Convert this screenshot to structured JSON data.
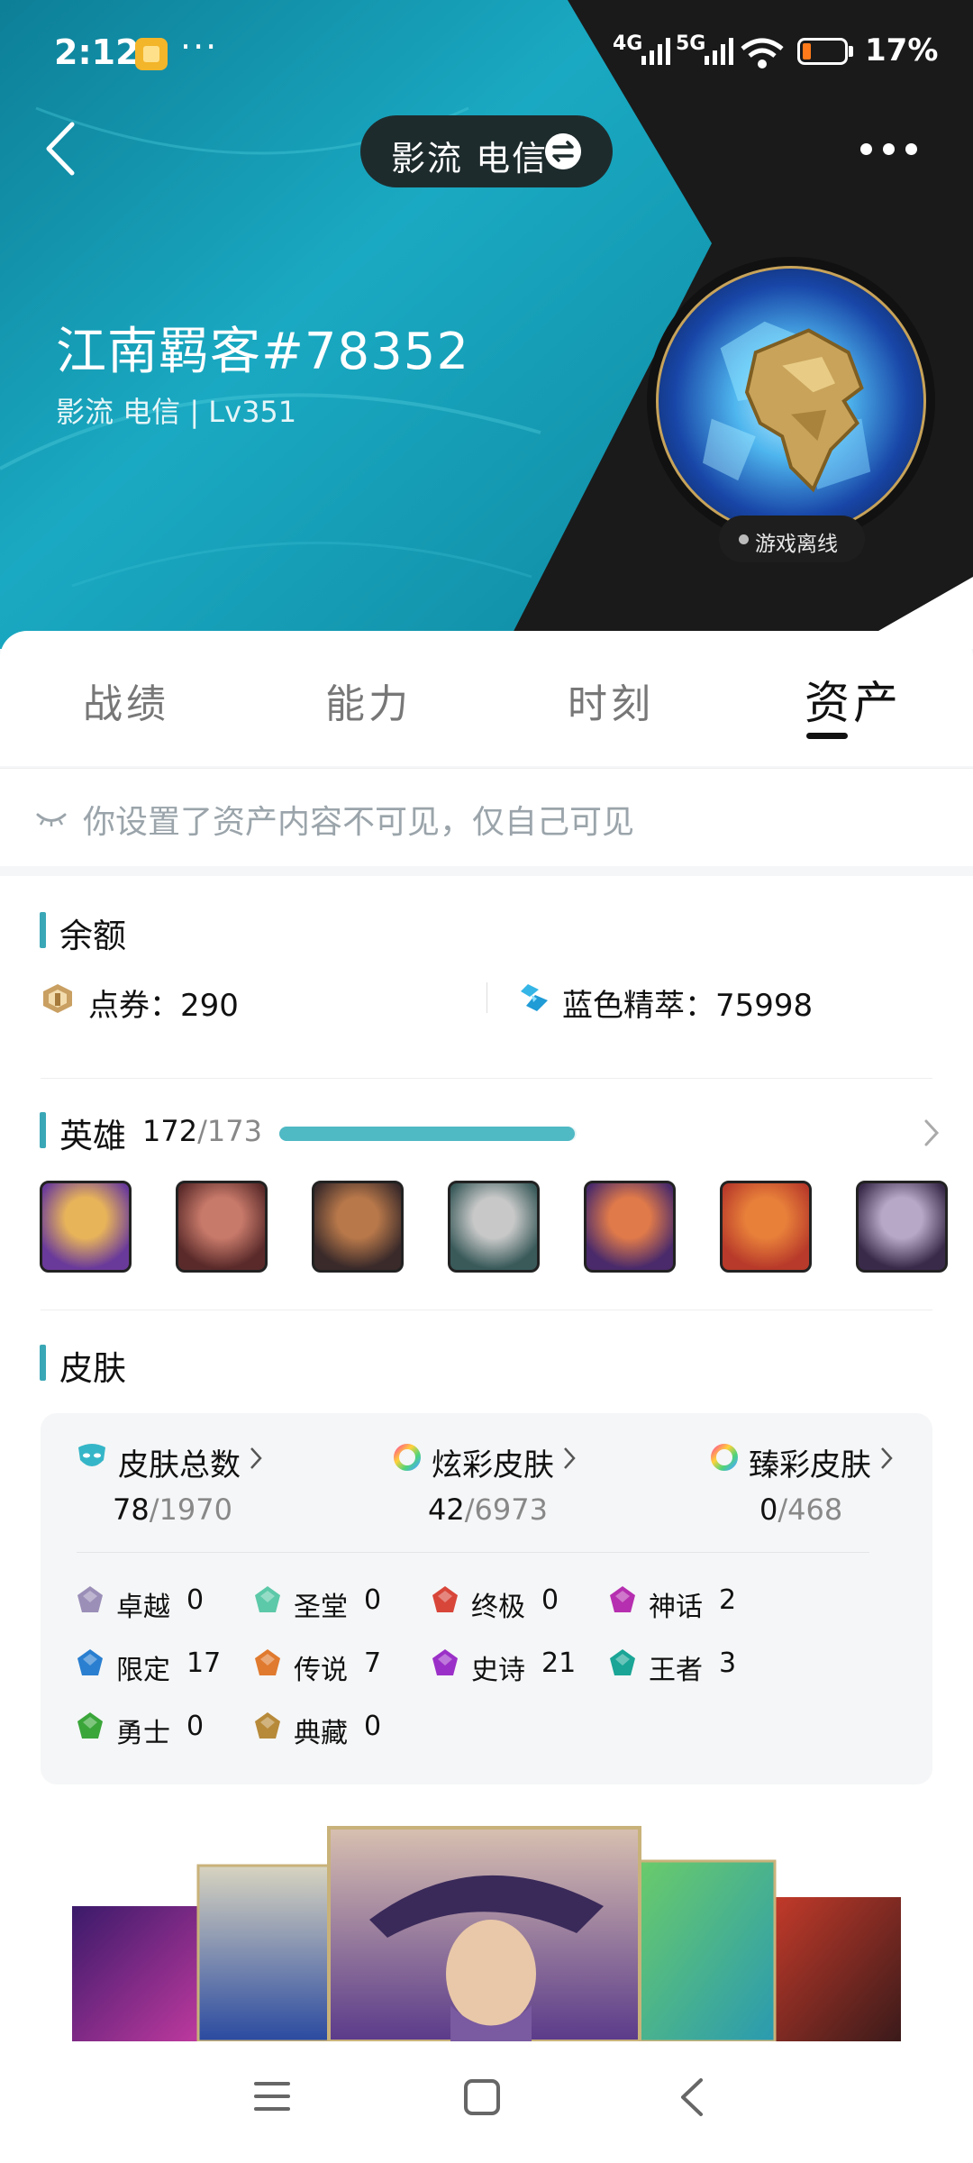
{
  "status_bar": {
    "time": "2:12",
    "dots": "···",
    "net1": "4G",
    "net2": "5G",
    "battery_pct": "17%"
  },
  "header": {
    "server_pill": "影流 电信",
    "username": "江南羁客#78352",
    "subinfo": "影流 电信 | Lv351",
    "status": "游戏离线"
  },
  "tabs": [
    {
      "label": "战绩",
      "active": false
    },
    {
      "label": "能力",
      "active": false
    },
    {
      "label": "时刻",
      "active": false
    },
    {
      "label": "资产",
      "active": true
    }
  ],
  "notice": "你设置了资产内容不可见，仅自己可见",
  "balance": {
    "title": "余额",
    "points_label": "点券：",
    "points_value": "290",
    "essence_label": "蓝色精萃：",
    "essence_value": "75998"
  },
  "heroes": {
    "title": "英雄",
    "owned": "172",
    "total": "/173",
    "progress": 0.994,
    "champions": [
      "champion-1",
      "champion-2",
      "champion-3",
      "champion-4",
      "champion-5",
      "champion-6",
      "champion-7"
    ]
  },
  "skins": {
    "title": "皮肤",
    "stats": [
      {
        "label": "皮肤总数",
        "owned": "78",
        "total": "/1970"
      },
      {
        "label": "炫彩皮肤",
        "owned": "42",
        "total": "/6973"
      },
      {
        "label": "臻彩皮肤",
        "owned": "0",
        "total": "/468"
      }
    ],
    "tiers": [
      {
        "name": "卓越",
        "count": "0",
        "color": "#9b8fb8"
      },
      {
        "name": "圣堂",
        "count": "0",
        "color": "#5cc9a8"
      },
      {
        "name": "终极",
        "count": "0",
        "color": "#d8463a"
      },
      {
        "name": "神话",
        "count": "2",
        "color": "#b62fb0"
      },
      {
        "name": "限定",
        "count": "17",
        "color": "#2a7fd0"
      },
      {
        "name": "传说",
        "count": "7",
        "color": "#e07a2e"
      },
      {
        "name": "史诗",
        "count": "21",
        "color": "#9b30c8"
      },
      {
        "name": "王者",
        "count": "3",
        "color": "#1aa596"
      },
      {
        "name": "勇士",
        "count": "0",
        "color": "#3aa63a"
      },
      {
        "name": "典藏",
        "count": "0",
        "color": "#b78a3a"
      }
    ]
  },
  "colors": {
    "accent": "#3aa7b6",
    "teal_header": "#1aa0b8"
  }
}
